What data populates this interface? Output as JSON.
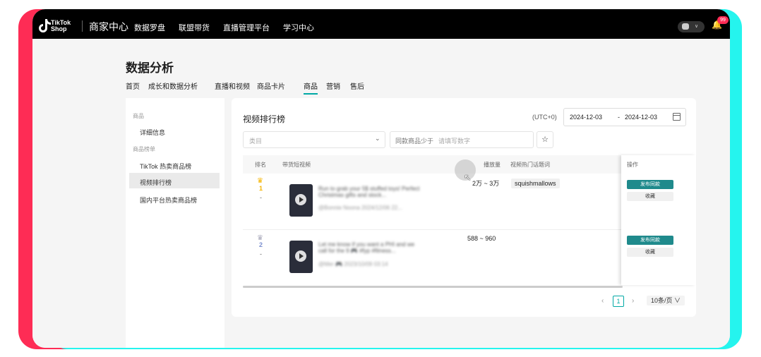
{
  "colors": {
    "accent": "#00a9a5",
    "primary_button": "#1f8a8c",
    "border_red": "#fe2c55",
    "border_cyan": "#25f4ee",
    "gold": "#f5b400"
  },
  "topbar": {
    "logo_line1": "TikTok",
    "logo_line2": "Shop",
    "brand": "商家中心",
    "nav": [
      "数据罗盘",
      "联盟带货",
      "直播管理平台",
      "学习中心"
    ],
    "notification_count": "99"
  },
  "page": {
    "title": "数据分析",
    "tabs": [
      "首页",
      "成长和数据分析",
      "直播和视频",
      "商品卡片",
      "商品",
      "营销",
      "售后"
    ],
    "active_tab": "商品"
  },
  "sidebar": {
    "group1": "商品",
    "item_detail": "详细信息",
    "group2": "商品榜单",
    "item_hot": "TikTok 热卖商品榜",
    "item_video": "视频排行榜",
    "item_domestic": "国内平台热卖商品榜"
  },
  "panel": {
    "title": "视频排行榜",
    "timezone": "(UTC+0)",
    "date_start": "2024-12-03",
    "date_sep": "-",
    "date_end": "2024-12-03",
    "category_placeholder": "类目",
    "range_prefix": "同款商品少于",
    "range_placeholder": "请填写数字",
    "star_icon": "star-icon"
  },
  "table": {
    "headers": {
      "rank": "排名",
      "video": "带货短视频",
      "views": "播放量",
      "hashtag": "视频热门话题词",
      "op": "操作"
    },
    "rows": [
      {
        "rank": "1",
        "rank_change": "-",
        "title": "Run to grab your 5$ stuffed toys! Perfect Christmas gifts and stock...",
        "meta": "@Bonnie Noona 2024/12/06 22...",
        "views": "2万 ~ 3万",
        "hashtag": "squishmallows",
        "publish": "发布同款",
        "collect": "收藏"
      },
      {
        "rank": "2",
        "rank_change": "-",
        "title": "Let me know if you want a PHI and we call for the 9 🎮 #fyp #fitness...",
        "meta": "@Mer 🎮 2023/10/09 03:14",
        "views": "588 ~ 960",
        "hashtag": "",
        "publish": "发布同款",
        "collect": "收藏"
      }
    ]
  },
  "pager": {
    "prev": "‹",
    "current": "1",
    "next": "›",
    "page_size": "10条/页 ∨"
  }
}
